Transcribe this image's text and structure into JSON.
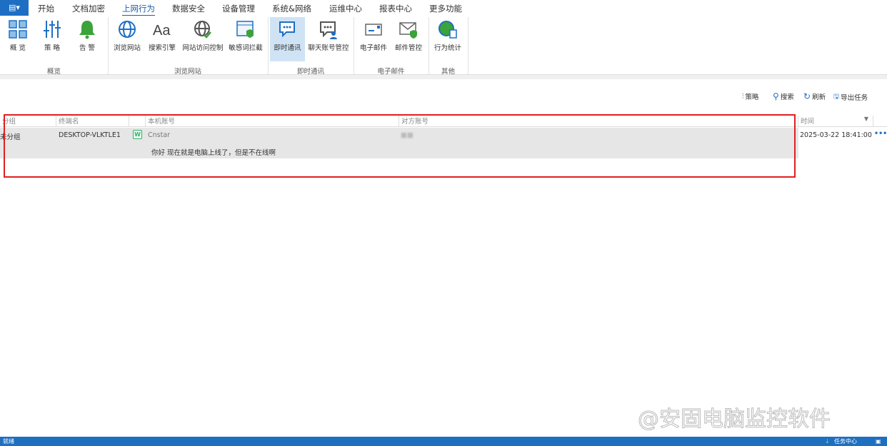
{
  "app_menu_icon": "document-menu-icon",
  "tabs": [
    "开始",
    "文档加密",
    "上网行为",
    "数据安全",
    "设备管理",
    "系统&网络",
    "运维中心",
    "报表中心",
    "更多功能"
  ],
  "active_tab": "上网行为",
  "ribbon": {
    "groups": [
      "概览",
      "浏览网站",
      "即时通讯",
      "电子邮件",
      "其他"
    ],
    "buttons": [
      "概 览",
      "策 略",
      "告 警",
      "浏览网站",
      "搜索引擎",
      "网站访问控制",
      "敏感词拦截",
      "即时通讯",
      "聊天账号管控",
      "电子邮件",
      "邮件管控",
      "行为统计"
    ],
    "selected": "即时通讯"
  },
  "toolbar": {
    "policy": "策略",
    "search": "搜索",
    "refresh": "刷新",
    "export": "导出任务"
  },
  "table": {
    "headers": {
      "group": "分组",
      "terminal": "终端名",
      "local_account": "本机账号",
      "peer_account": "对方账号",
      "time": "时间"
    },
    "rows": [
      {
        "group": "未分组",
        "terminal": "DESKTOP-VLKTLE1",
        "app_badge": "W",
        "local_account": "Cnstar",
        "peer_account": "■■",
        "message": "你好 现在就是电脑上线了，但是不在线啊",
        "time": "2025-03-22 18:41:00",
        "more": "•••"
      }
    ]
  },
  "status": {
    "left": "就绪",
    "task_center": "任务中心"
  },
  "watermark": "@安固电脑监控软件",
  "colors": {
    "accent": "#1e6fc4",
    "highlight": "#e02020",
    "row_bg": "#e6e6e6"
  }
}
